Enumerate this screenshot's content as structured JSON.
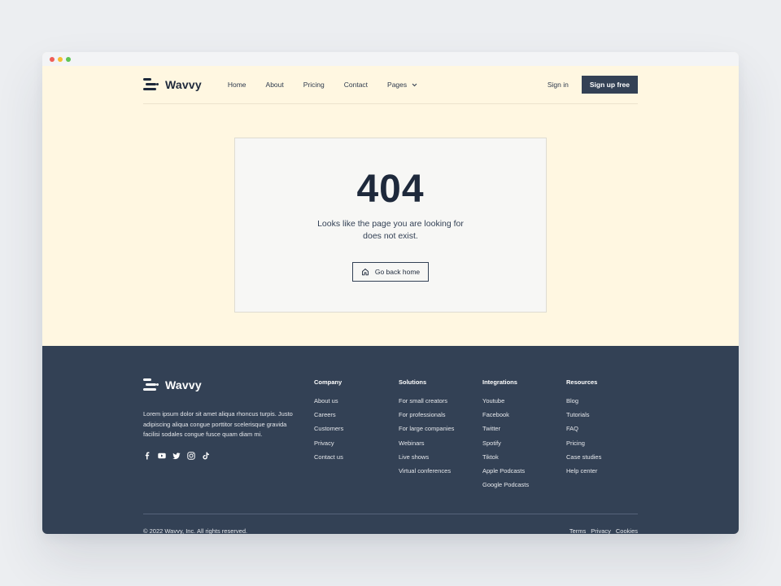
{
  "colors": {
    "hero_bg": "#fff7e1",
    "footer_bg": "#334155",
    "primary_btn": "#334155",
    "dot_red": "#ef5e57",
    "dot_yellow": "#f6bd33",
    "dot_green": "#5fc454"
  },
  "nav": {
    "brand": "Wavvy",
    "logo_icon": "wavvy-logo-icon",
    "links": [
      "Home",
      "About",
      "Pricing",
      "Contact"
    ],
    "pages_label": "Pages",
    "sign_in": "Sign in",
    "sign_up": "Sign up free"
  },
  "error": {
    "code": "404",
    "message": "Looks like the page you are looking for does not exist.",
    "home_button": "Go back home",
    "home_icon": "house-icon"
  },
  "footer": {
    "brand": "Wavvy",
    "description": "Lorem ipsum dolor sit amet aliqua rhoncus turpis. Justo adipiscing aliqua congue porttitor scelerisque gravida facilisi sodales congue fusce quam diam mi.",
    "socials": [
      "facebook-icon",
      "youtube-icon",
      "twitter-icon",
      "instagram-icon",
      "tiktok-icon"
    ],
    "columns": [
      {
        "title": "Company",
        "items": [
          "About us",
          "Careers",
          "Customers",
          "Privacy",
          "Contact us"
        ]
      },
      {
        "title": "Solutions",
        "items": [
          "For small creators",
          "For professionals",
          "For large companies",
          "Webinars",
          "Live shows",
          "Virtual conferences"
        ]
      },
      {
        "title": "Integrations",
        "items": [
          "Youtube",
          "Facebook",
          "Twitter",
          "Spotify",
          "Tiktok",
          "Apple Podcasts",
          "Google Podcasts"
        ]
      },
      {
        "title": "Resources",
        "items": [
          "Blog",
          "Tutorials",
          "FAQ",
          "Pricing",
          "Case studies",
          "Help center"
        ]
      }
    ],
    "copyright": "© 2022 Wavvy, Inc. All rights reserved.",
    "legal": [
      "Terms",
      "Privacy",
      "Cookies"
    ]
  }
}
